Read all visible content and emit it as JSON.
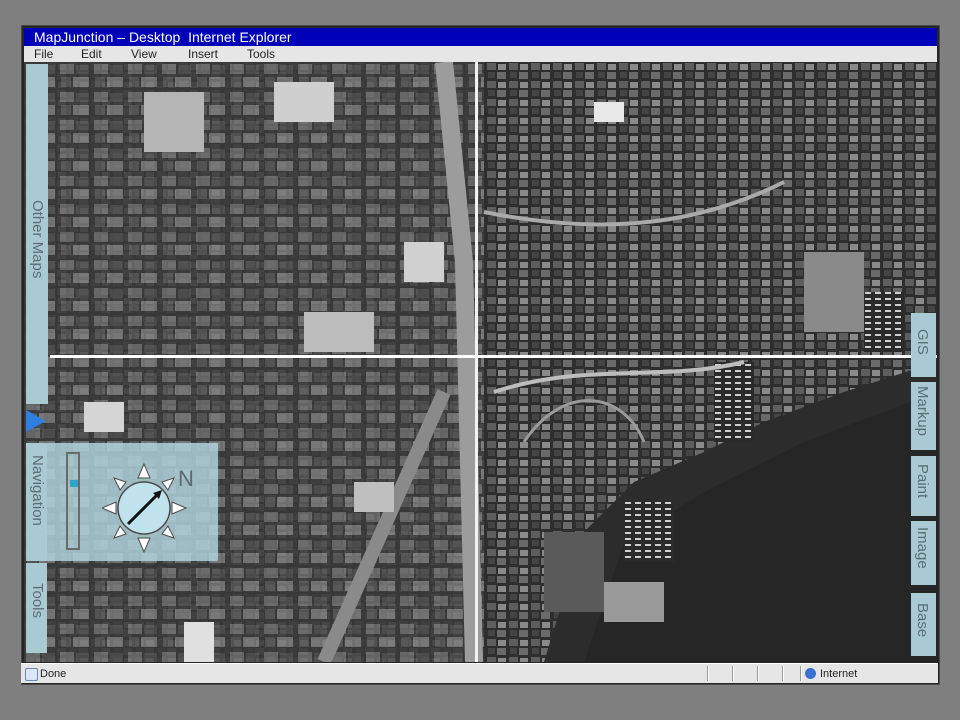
{
  "window": {
    "title": "MapJunction – Desktop  Internet Explorer"
  },
  "menu": {
    "items": [
      "File",
      "Edit",
      "View",
      "Insert",
      "Tools"
    ]
  },
  "left_tabs": {
    "other_maps": "Other Maps",
    "navigation": "Navigation",
    "tools": "Tools"
  },
  "right_tabs": {
    "gis": "GIS",
    "markup": "Markup",
    "paint": "Paint",
    "image": "Image",
    "base": "Base"
  },
  "navigation": {
    "north_label": "N",
    "zoom_level": 0.3
  },
  "status": {
    "text": "Done",
    "zone": "Internet"
  },
  "colors": {
    "titlebar": "#0000b8",
    "panel": "#a9c9d3",
    "accent": "#2f7fe0"
  },
  "icons": [
    "compass-rose-icon",
    "ie-page-icon",
    "internet-globe-icon",
    "play-arrow-icon"
  ]
}
